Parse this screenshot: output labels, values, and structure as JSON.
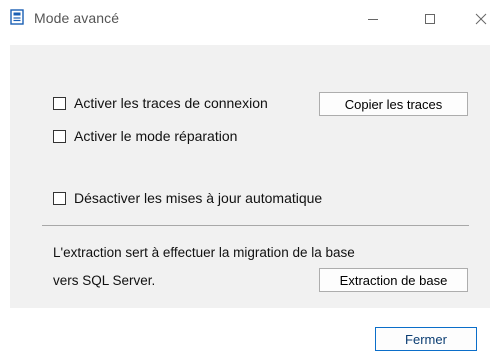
{
  "window": {
    "title": "Mode avancé",
    "controls": [
      "minimize-icon",
      "maximize-icon",
      "close-icon"
    ]
  },
  "options": [
    {
      "label": "Activer les traces de connexion",
      "checked": false
    },
    {
      "label": "Activer le mode réparation",
      "checked": false
    },
    {
      "label": "Désactiver les mises à jour automatique",
      "checked": false
    }
  ],
  "buttons": {
    "copy_traces": "Copier les traces",
    "extract_db": "Extraction de base",
    "close": "Fermer"
  },
  "info": {
    "line1": "L'extraction sert à effectuer la migration de la base",
    "line2": "vers SQL Server."
  },
  "colors": {
    "panel_bg": "#f1f1f1",
    "focus_border": "#0b6ec9",
    "app_icon": "#1a5fb4"
  }
}
